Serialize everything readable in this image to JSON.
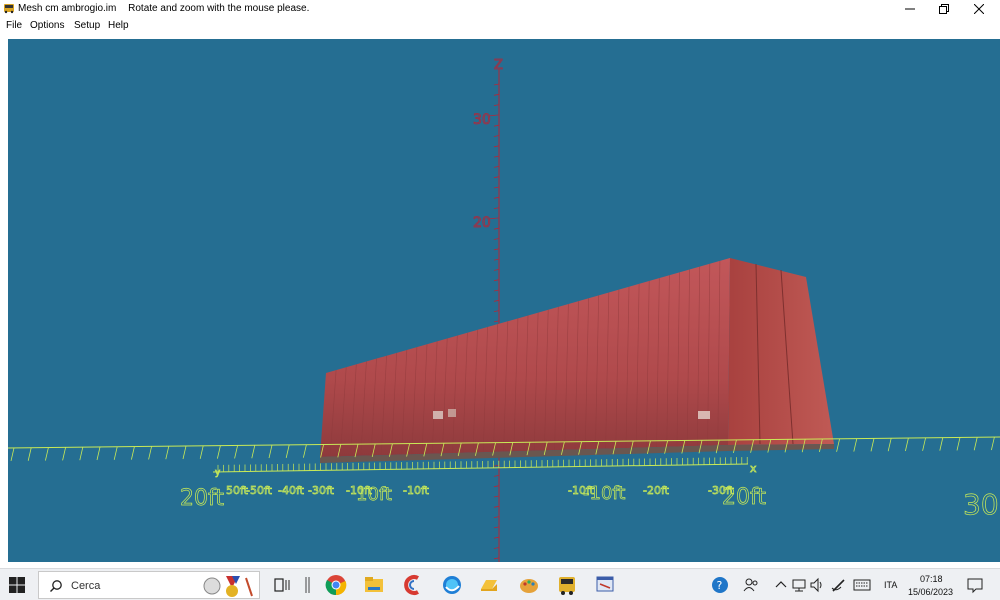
{
  "window": {
    "title": "Mesh cm ambrogio.im",
    "hint": "Rotate and zoom with the mouse please."
  },
  "menu": {
    "items": [
      {
        "label": "File"
      },
      {
        "label": "Options"
      },
      {
        "label": "Setup"
      },
      {
        "label": "Help"
      }
    ]
  },
  "viewport": {
    "background": "#256e92",
    "grid_color": "#c9ea57",
    "z_axis_color": "#b0283a",
    "container_color": "#b5464a",
    "z_axis": {
      "label": "Z",
      "ticks": [
        "30",
        "20"
      ]
    },
    "x_axis": {
      "label": "x"
    },
    "y_axis": {
      "label": "y"
    },
    "near_labels": [
      "20ft",
      "10ft",
      "-10ft",
      "20ft",
      "30"
    ],
    "far_labels": [
      "50ft",
      "-50ft",
      "-40ft",
      "-30ft",
      "-10ft",
      "-10ft",
      "-10ft",
      "-20ft",
      "-30ft"
    ]
  },
  "taskbar": {
    "search_placeholder": "Cerca",
    "language": "ITA",
    "time": "07:18",
    "date": "15/06/2023",
    "apps": [
      "task-view",
      "chrome",
      "file-explorer",
      "creative-cloud",
      "edge",
      "onedrive",
      "paint",
      "app-bus",
      "app-window"
    ]
  }
}
